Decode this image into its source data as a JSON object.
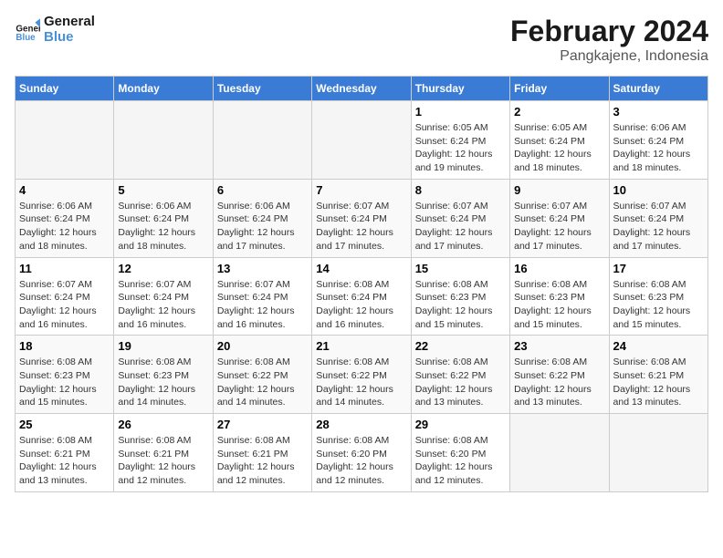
{
  "logo": {
    "line1": "General",
    "line2": "Blue"
  },
  "title": "February 2024",
  "subtitle": "Pangkajene, Indonesia",
  "days_of_week": [
    "Sunday",
    "Monday",
    "Tuesday",
    "Wednesday",
    "Thursday",
    "Friday",
    "Saturday"
  ],
  "weeks": [
    [
      {
        "day": "",
        "info": ""
      },
      {
        "day": "",
        "info": ""
      },
      {
        "day": "",
        "info": ""
      },
      {
        "day": "",
        "info": ""
      },
      {
        "day": "1",
        "info": "Sunrise: 6:05 AM\nSunset: 6:24 PM\nDaylight: 12 hours\nand 19 minutes."
      },
      {
        "day": "2",
        "info": "Sunrise: 6:05 AM\nSunset: 6:24 PM\nDaylight: 12 hours\nand 18 minutes."
      },
      {
        "day": "3",
        "info": "Sunrise: 6:06 AM\nSunset: 6:24 PM\nDaylight: 12 hours\nand 18 minutes."
      }
    ],
    [
      {
        "day": "4",
        "info": "Sunrise: 6:06 AM\nSunset: 6:24 PM\nDaylight: 12 hours\nand 18 minutes."
      },
      {
        "day": "5",
        "info": "Sunrise: 6:06 AM\nSunset: 6:24 PM\nDaylight: 12 hours\nand 18 minutes."
      },
      {
        "day": "6",
        "info": "Sunrise: 6:06 AM\nSunset: 6:24 PM\nDaylight: 12 hours\nand 17 minutes."
      },
      {
        "day": "7",
        "info": "Sunrise: 6:07 AM\nSunset: 6:24 PM\nDaylight: 12 hours\nand 17 minutes."
      },
      {
        "day": "8",
        "info": "Sunrise: 6:07 AM\nSunset: 6:24 PM\nDaylight: 12 hours\nand 17 minutes."
      },
      {
        "day": "9",
        "info": "Sunrise: 6:07 AM\nSunset: 6:24 PM\nDaylight: 12 hours\nand 17 minutes."
      },
      {
        "day": "10",
        "info": "Sunrise: 6:07 AM\nSunset: 6:24 PM\nDaylight: 12 hours\nand 17 minutes."
      }
    ],
    [
      {
        "day": "11",
        "info": "Sunrise: 6:07 AM\nSunset: 6:24 PM\nDaylight: 12 hours\nand 16 minutes."
      },
      {
        "day": "12",
        "info": "Sunrise: 6:07 AM\nSunset: 6:24 PM\nDaylight: 12 hours\nand 16 minutes."
      },
      {
        "day": "13",
        "info": "Sunrise: 6:07 AM\nSunset: 6:24 PM\nDaylight: 12 hours\nand 16 minutes."
      },
      {
        "day": "14",
        "info": "Sunrise: 6:08 AM\nSunset: 6:24 PM\nDaylight: 12 hours\nand 16 minutes."
      },
      {
        "day": "15",
        "info": "Sunrise: 6:08 AM\nSunset: 6:23 PM\nDaylight: 12 hours\nand 15 minutes."
      },
      {
        "day": "16",
        "info": "Sunrise: 6:08 AM\nSunset: 6:23 PM\nDaylight: 12 hours\nand 15 minutes."
      },
      {
        "day": "17",
        "info": "Sunrise: 6:08 AM\nSunset: 6:23 PM\nDaylight: 12 hours\nand 15 minutes."
      }
    ],
    [
      {
        "day": "18",
        "info": "Sunrise: 6:08 AM\nSunset: 6:23 PM\nDaylight: 12 hours\nand 15 minutes."
      },
      {
        "day": "19",
        "info": "Sunrise: 6:08 AM\nSunset: 6:23 PM\nDaylight: 12 hours\nand 14 minutes."
      },
      {
        "day": "20",
        "info": "Sunrise: 6:08 AM\nSunset: 6:22 PM\nDaylight: 12 hours\nand 14 minutes."
      },
      {
        "day": "21",
        "info": "Sunrise: 6:08 AM\nSunset: 6:22 PM\nDaylight: 12 hours\nand 14 minutes."
      },
      {
        "day": "22",
        "info": "Sunrise: 6:08 AM\nSunset: 6:22 PM\nDaylight: 12 hours\nand 13 minutes."
      },
      {
        "day": "23",
        "info": "Sunrise: 6:08 AM\nSunset: 6:22 PM\nDaylight: 12 hours\nand 13 minutes."
      },
      {
        "day": "24",
        "info": "Sunrise: 6:08 AM\nSunset: 6:21 PM\nDaylight: 12 hours\nand 13 minutes."
      }
    ],
    [
      {
        "day": "25",
        "info": "Sunrise: 6:08 AM\nSunset: 6:21 PM\nDaylight: 12 hours\nand 13 minutes."
      },
      {
        "day": "26",
        "info": "Sunrise: 6:08 AM\nSunset: 6:21 PM\nDaylight: 12 hours\nand 12 minutes."
      },
      {
        "day": "27",
        "info": "Sunrise: 6:08 AM\nSunset: 6:21 PM\nDaylight: 12 hours\nand 12 minutes."
      },
      {
        "day": "28",
        "info": "Sunrise: 6:08 AM\nSunset: 6:20 PM\nDaylight: 12 hours\nand 12 minutes."
      },
      {
        "day": "29",
        "info": "Sunrise: 6:08 AM\nSunset: 6:20 PM\nDaylight: 12 hours\nand 12 minutes."
      },
      {
        "day": "",
        "info": ""
      },
      {
        "day": "",
        "info": ""
      }
    ]
  ]
}
